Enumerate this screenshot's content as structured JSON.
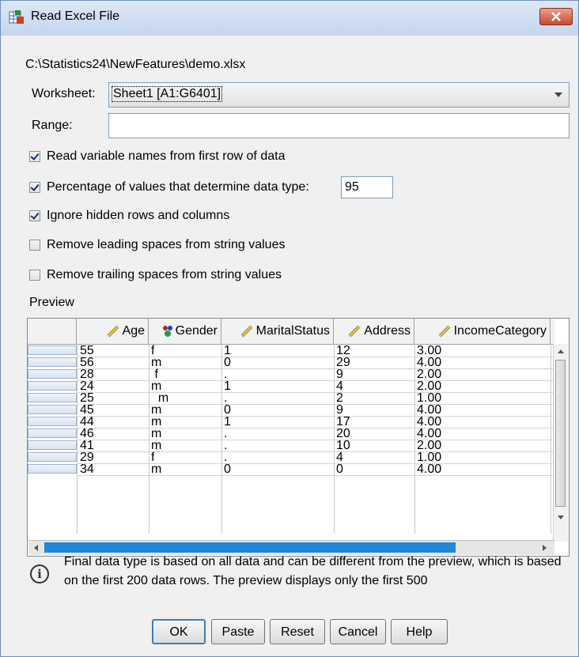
{
  "window": {
    "title": "Read Excel File"
  },
  "file_path": "C:\\Statistics24\\NewFeatures\\demo.xlsx",
  "worksheet": {
    "label": "Worksheet:",
    "value": "Sheet1 [A1:G6401]"
  },
  "range": {
    "label": "Range:",
    "value": ""
  },
  "options": [
    {
      "label": "Read variable names from first row of data",
      "checked": true
    },
    {
      "label": "Percentage of values that determine data type:",
      "checked": true
    },
    {
      "label": "Ignore hidden rows and columns",
      "checked": true
    },
    {
      "label": "Remove leading spaces from string values",
      "checked": false
    },
    {
      "label": "Remove trailing spaces from string values",
      "checked": false
    }
  ],
  "percentage_value": "95",
  "preview": {
    "label": "Preview",
    "columns": [
      {
        "name": "Age",
        "icon": "scale-ruler-icon"
      },
      {
        "name": "Gender",
        "icon": "nominal-string-icon"
      },
      {
        "name": "MaritalStatus",
        "icon": "scale-ruler-icon"
      },
      {
        "name": "Address",
        "icon": "scale-ruler-icon"
      },
      {
        "name": "IncomeCategory",
        "icon": "scale-ruler-icon"
      }
    ],
    "rows": [
      [
        "55",
        "f",
        "1",
        "12",
        "3.00"
      ],
      [
        "56",
        "m",
        "0",
        "29",
        "4.00"
      ],
      [
        "28",
        " f",
        ".",
        "9",
        "2.00"
      ],
      [
        "24",
        "m",
        "1",
        "4",
        "2.00"
      ],
      [
        "25",
        "  m",
        ".",
        "2",
        "1.00"
      ],
      [
        "45",
        "m",
        "0",
        "9",
        "4.00"
      ],
      [
        "44",
        "m",
        "1",
        "17",
        "4.00"
      ],
      [
        "46",
        "m",
        ".",
        "20",
        "4.00"
      ],
      [
        "41",
        "m",
        ".",
        "10",
        "2.00"
      ],
      [
        "29",
        "f",
        ".",
        "4",
        "1.00"
      ],
      [
        "34",
        "m",
        "0",
        "0",
        "4.00"
      ]
    ]
  },
  "info": {
    "icon": "info-icon",
    "text": "Final data type is based on all data and can be different from the preview, which is based on the first 200 data rows. The preview displays only the first 500"
  },
  "buttons": {
    "ok": "OK",
    "paste": "Paste",
    "reset": "Reset",
    "cancel": "Cancel",
    "help": "Help"
  },
  "colors": {
    "title_bar": "#c4d5ee",
    "close_button": "#c64a34",
    "scrollbar_thumb": "#1e87d6",
    "default_button_border": "#3c7fb1"
  }
}
